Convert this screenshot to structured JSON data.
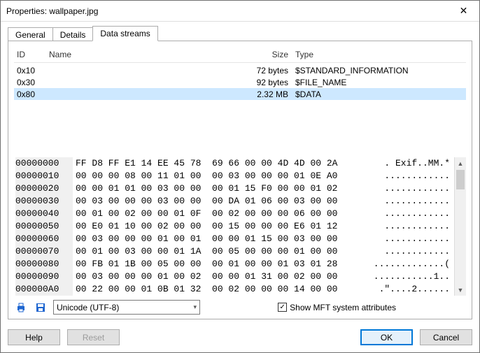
{
  "window": {
    "title": "Properties: wallpaper.jpg"
  },
  "tabs": {
    "general": "General",
    "details": "Details",
    "data_streams": "Data streams"
  },
  "columns": {
    "id": "ID",
    "name": "Name",
    "size": "Size",
    "type": "Type"
  },
  "rows": [
    {
      "id": "0x10",
      "name": "",
      "size": "72 bytes",
      "type": "$STANDARD_INFORMATION"
    },
    {
      "id": "0x30",
      "name": "",
      "size": "92 bytes",
      "type": "$FILE_NAME"
    },
    {
      "id": "0x80",
      "name": "",
      "size": "2.32 MB",
      "type": "$DATA"
    }
  ],
  "hex": [
    {
      "off": "00000000",
      "b": "FF D8 FF E1 14 EE 45 78  69 66 00 00 4D 4D 00 2A",
      "a": ". Exif..MM.*"
    },
    {
      "off": "00000010",
      "b": "00 00 00 08 00 11 01 00  00 03 00 00 00 01 0E A0",
      "a": "............"
    },
    {
      "off": "00000020",
      "b": "00 00 01 01 00 03 00 00  00 01 15 F0 00 00 01 02",
      "a": "............"
    },
    {
      "off": "00000030",
      "b": "00 03 00 00 00 03 00 00  00 DA 01 06 00 03 00 00",
      "a": "............"
    },
    {
      "off": "00000040",
      "b": "00 01 00 02 00 00 01 0F  00 02 00 00 00 06 00 00",
      "a": "............"
    },
    {
      "off": "00000050",
      "b": "00 E0 01 10 00 02 00 00  00 15 00 00 00 E6 01 12",
      "a": "............"
    },
    {
      "off": "00000060",
      "b": "00 03 00 00 00 01 00 01  00 00 01 15 00 03 00 00",
      "a": "............"
    },
    {
      "off": "00000070",
      "b": "00 01 00 03 00 00 01 1A  00 05 00 00 00 01 00 00",
      "a": "............"
    },
    {
      "off": "00000080",
      "b": "00 FB 01 1B 00 05 00 00  00 01 00 00 01 03 01 28",
      "a": ".............("
    },
    {
      "off": "00000090",
      "b": "00 03 00 00 00 01 00 02  00 00 01 31 00 02 00 00",
      "a": "...........1.."
    },
    {
      "off": "000000A0",
      "b": "00 22 00 00 01 0B 01 32  00 02 00 00 00 14 00 00",
      "a": ".\"....2......"
    }
  ],
  "encoding": {
    "selected": "Unicode (UTF-8)"
  },
  "checkbox": {
    "label": "Show MFT system attributes"
  },
  "buttons": {
    "help": "Help",
    "reset": "Reset",
    "ok": "OK",
    "cancel": "Cancel"
  }
}
